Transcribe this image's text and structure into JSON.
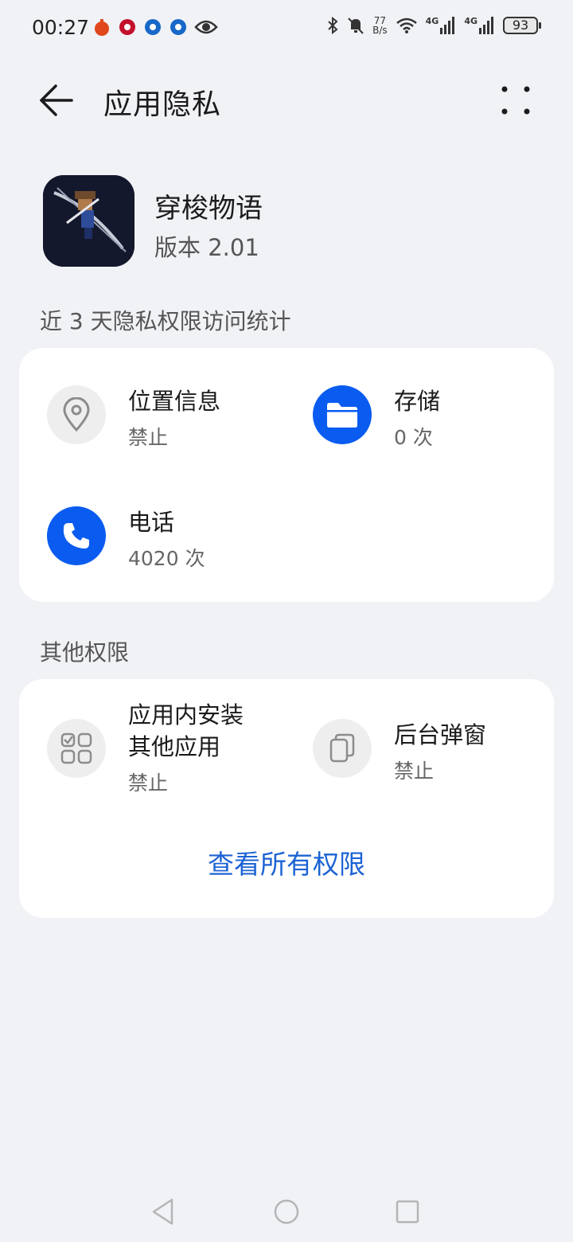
{
  "status_bar": {
    "time": "00:27",
    "net_speed_top": "77",
    "net_speed_bottom": "B/s",
    "network_1": "4G",
    "network_2": "4G",
    "battery": "93"
  },
  "header": {
    "title": "应用隐私"
  },
  "app": {
    "name": "穿梭物语",
    "version": "版本 2.01"
  },
  "stats_section": {
    "label": "近 3 天隐私权限访问统计",
    "items": [
      {
        "title": "位置信息",
        "sub": "禁止",
        "icon": "location-pin-icon"
      },
      {
        "title": "存储",
        "sub": "0 次",
        "icon": "folder-icon"
      },
      {
        "title": "电话",
        "sub": "4020 次",
        "icon": "phone-icon"
      }
    ]
  },
  "other_section": {
    "label": "其他权限",
    "items": [
      {
        "title": "应用内安装\n其他应用",
        "sub": "禁止",
        "icon": "app-grid-icon"
      },
      {
        "title": "后台弹窗",
        "sub": "禁止",
        "icon": "popup-window-icon"
      }
    ],
    "view_all": "查看所有权限"
  },
  "colors": {
    "accent": "#0a5cf0",
    "link": "#1c63d4",
    "background": "#f1f2f6"
  }
}
